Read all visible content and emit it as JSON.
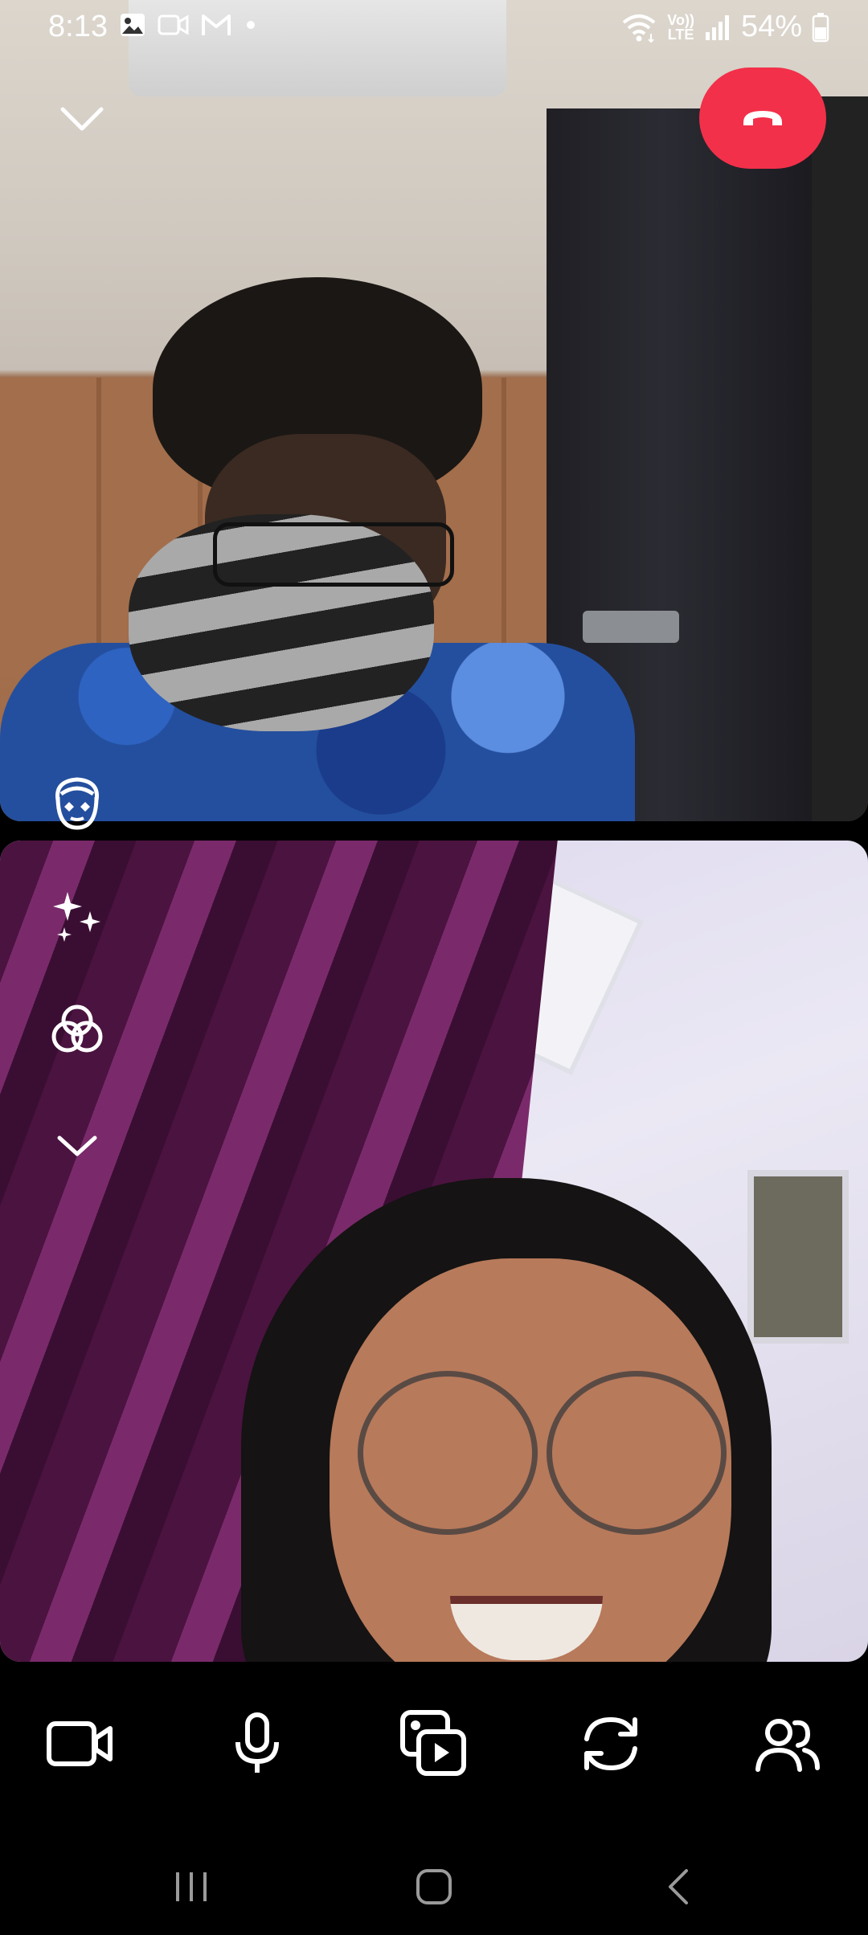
{
  "status_bar": {
    "time": "8:13",
    "battery": "54%",
    "network_label_top": "Vo))",
    "network_label_bottom": "LTE",
    "left_icons": [
      "gallery-icon",
      "video-icon",
      "gmail-icon",
      "dot-icon"
    ],
    "right_icons": [
      "wifi-icon",
      "volte-icon",
      "signal-icon",
      "battery-icon"
    ]
  },
  "call": {
    "end_call_color": "#f2304a",
    "controls_top": [
      "minimize-icon",
      "end-call-icon"
    ],
    "side_controls": [
      "face-filter-icon",
      "effects-sparkle-icon",
      "color-filter-icon",
      "collapse-chevron-icon"
    ]
  },
  "toolbar": {
    "buttons": [
      "video-camera-icon",
      "microphone-icon",
      "media-share-icon",
      "flip-camera-icon",
      "participants-icon"
    ]
  },
  "navigation": {
    "buttons": [
      "recents-icon",
      "home-icon",
      "back-icon"
    ]
  }
}
